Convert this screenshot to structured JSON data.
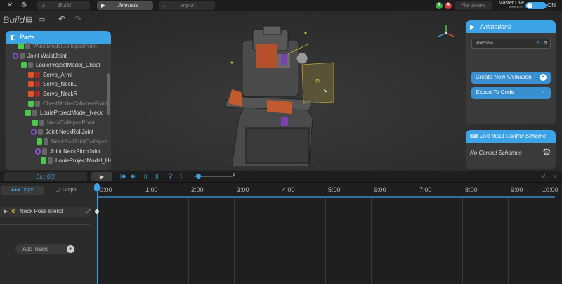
{
  "topbar": {
    "build_label": "Build",
    "animate_label": "Animate",
    "import_label": "Import",
    "hardware_label": "Hardware",
    "badge_green": "1",
    "badge_red": "6",
    "master_live_label": "Master Live",
    "stop_hint": "stop ESC",
    "toggle_label": "ON"
  },
  "toolbar": {
    "build_title": "Build"
  },
  "parts_panel": {
    "title": "Parts",
    "items": [
      {
        "label": "WaistModelCollapsePoint",
        "indent": 26,
        "icon": "collapse-point",
        "dim": true
      },
      {
        "label": "Joint WaistJoint",
        "indent": 18,
        "icon": "joint",
        "dim": false
      },
      {
        "label": "LouieProjectModel_Chest",
        "indent": 30,
        "icon": "model",
        "dim": false
      },
      {
        "label": "Servo_ArmI",
        "indent": 40,
        "icon": "servo",
        "dim": false
      },
      {
        "label": "Servo_NeckL",
        "indent": 40,
        "icon": "servo",
        "dim": false
      },
      {
        "label": "Servo_NeckR",
        "indent": 40,
        "icon": "servo",
        "dim": false
      },
      {
        "label": "ChestModelCollapsePoint",
        "indent": 40,
        "icon": "collapse-point",
        "dim": true
      },
      {
        "label": "LouieProjectModel_Neck",
        "indent": 36,
        "icon": "model",
        "dim": false
      },
      {
        "label": "NeckCollapsePoint",
        "indent": 46,
        "icon": "collapse-point",
        "dim": true
      },
      {
        "label": "Joint NeckRollJoint",
        "indent": 44,
        "icon": "joint",
        "dim": false
      },
      {
        "label": "NeckRollJointCollapse",
        "indent": 52,
        "icon": "collapse-point",
        "dim": true
      },
      {
        "label": "Joint NeckPitchJoint",
        "indent": 50,
        "icon": "joint",
        "dim": false
      },
      {
        "label": "LouieProjectModel_Heac",
        "indent": 58,
        "icon": "model",
        "dim": false
      }
    ]
  },
  "animations_panel": {
    "title": "Animations",
    "current": "Welcome",
    "create_label": "Create New Animation",
    "export_label": "Export To Code"
  },
  "live_panel": {
    "title": "Live Input Control Scheme",
    "status": "No Control Schemes"
  },
  "timeline": {
    "time_display": "0s : 00!",
    "marker_label": "A",
    "dope_label": "Dope",
    "graph_label": "Graph",
    "track_name": "Neck Pose Blend",
    "add_track_label": "Add Track",
    "ticks": [
      "0:00",
      "1:00",
      "2:00",
      "3:00",
      "4:00",
      "5:00",
      "6:00",
      "7:00",
      "8:00",
      "9:00",
      "10:00"
    ]
  },
  "colors": {
    "accent": "#3ba3e6",
    "servo": "#e0542a",
    "joint": "#8a4fd0",
    "model": "#4cc94c"
  }
}
